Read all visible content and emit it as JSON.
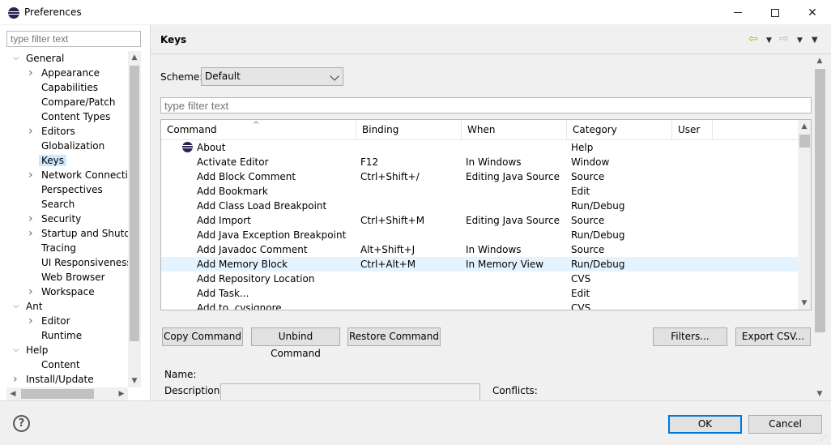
{
  "window": {
    "title": "Preferences"
  },
  "left": {
    "filter_placeholder": "type filter text",
    "tree": [
      {
        "label": "General",
        "level": 0,
        "twisty": "open"
      },
      {
        "label": "Appearance",
        "level": 1,
        "twisty": "closed"
      },
      {
        "label": "Capabilities",
        "level": 1,
        "twisty": ""
      },
      {
        "label": "Compare/Patch",
        "level": 1,
        "twisty": ""
      },
      {
        "label": "Content Types",
        "level": 1,
        "twisty": ""
      },
      {
        "label": "Editors",
        "level": 1,
        "twisty": "closed"
      },
      {
        "label": "Globalization",
        "level": 1,
        "twisty": ""
      },
      {
        "label": "Keys",
        "level": 1,
        "twisty": "",
        "selected": true
      },
      {
        "label": "Network Connection",
        "level": 1,
        "twisty": "closed"
      },
      {
        "label": "Perspectives",
        "level": 1,
        "twisty": ""
      },
      {
        "label": "Search",
        "level": 1,
        "twisty": ""
      },
      {
        "label": "Security",
        "level": 1,
        "twisty": "closed"
      },
      {
        "label": "Startup and Shutdow",
        "level": 1,
        "twisty": "closed"
      },
      {
        "label": "Tracing",
        "level": 1,
        "twisty": ""
      },
      {
        "label": "UI Responsiveness M",
        "level": 1,
        "twisty": ""
      },
      {
        "label": "Web Browser",
        "level": 1,
        "twisty": ""
      },
      {
        "label": "Workspace",
        "level": 1,
        "twisty": "closed"
      },
      {
        "label": "Ant",
        "level": 0,
        "twisty": "open"
      },
      {
        "label": "Editor",
        "level": 1,
        "twisty": "closed"
      },
      {
        "label": "Runtime",
        "level": 1,
        "twisty": ""
      },
      {
        "label": "Help",
        "level": 0,
        "twisty": "open"
      },
      {
        "label": "Content",
        "level": 1,
        "twisty": ""
      },
      {
        "label": "Install/Update",
        "level": 0,
        "twisty": "closed"
      }
    ]
  },
  "page": {
    "title": "Keys",
    "scheme_label": "Scheme:",
    "scheme_value": "Default",
    "filter_placeholder": "type filter text",
    "columns": [
      "Command",
      "Binding",
      "When",
      "Category",
      "User"
    ],
    "rows": [
      {
        "command": "About",
        "binding": "",
        "when": "",
        "category": "Help",
        "icon": true
      },
      {
        "command": "Activate Editor",
        "binding": "F12",
        "when": "In Windows",
        "category": "Window"
      },
      {
        "command": "Add Block Comment",
        "binding": "Ctrl+Shift+/",
        "when": "Editing Java Source",
        "category": "Source"
      },
      {
        "command": "Add Bookmark",
        "binding": "",
        "when": "",
        "category": "Edit"
      },
      {
        "command": "Add Class Load Breakpoint",
        "binding": "",
        "when": "",
        "category": "Run/Debug"
      },
      {
        "command": "Add Import",
        "binding": "Ctrl+Shift+M",
        "when": "Editing Java Source",
        "category": "Source"
      },
      {
        "command": "Add Java Exception Breakpoint",
        "binding": "",
        "when": "",
        "category": "Run/Debug"
      },
      {
        "command": "Add Javadoc Comment",
        "binding": "Alt+Shift+J",
        "when": "In Windows",
        "category": "Source"
      },
      {
        "command": "Add Memory Block",
        "binding": "Ctrl+Alt+M",
        "when": "In Memory View",
        "category": "Run/Debug",
        "highlight": true
      },
      {
        "command": "Add Repository Location",
        "binding": "",
        "when": "",
        "category": "CVS"
      },
      {
        "command": "Add Task...",
        "binding": "",
        "when": "",
        "category": "Edit"
      },
      {
        "command": "Add to .cvsignore",
        "binding": "",
        "when": "",
        "category": "CVS"
      }
    ],
    "buttons": {
      "copy": "Copy Command",
      "unbind": "Unbind Command",
      "restore": "Restore Command",
      "filters": "Filters...",
      "export": "Export CSV..."
    },
    "name_label": "Name:",
    "description_label": "Description:",
    "conflicts_label": "Conflicts:"
  },
  "footer": {
    "ok": "OK",
    "cancel": "Cancel"
  }
}
